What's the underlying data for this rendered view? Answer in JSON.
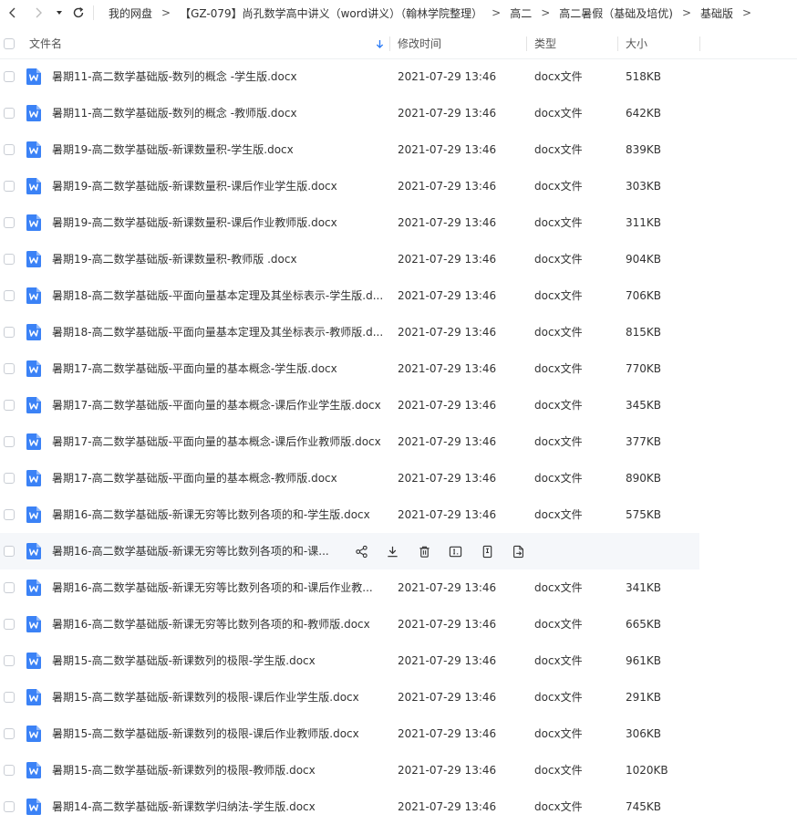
{
  "nav": {
    "back_icon": "chevron-left-icon",
    "forward_icon": "chevron-right-icon",
    "dropdown_icon": "caret-down-icon",
    "refresh_icon": "refresh-icon"
  },
  "breadcrumb": {
    "separator": ">",
    "items": [
      "我的网盘",
      "【GZ-079】尚孔数学高中讲义（word讲义）（翰林学院整理）",
      "高二",
      "高二暑假（基础及培优)",
      "基础版"
    ]
  },
  "table": {
    "columns": {
      "name": "文件名",
      "modified": "修改时间",
      "type": "类型",
      "size": "大小"
    },
    "sort_icon": "arrow-down-icon",
    "rows": [
      {
        "name": "暑期11-高二数学基础版-数列的概念 -学生版.docx",
        "modified": "2021-07-29 13:46",
        "type": "docx文件",
        "size": "518KB"
      },
      {
        "name": "暑期11-高二数学基础版-数列的概念 -教师版.docx",
        "modified": "2021-07-29 13:46",
        "type": "docx文件",
        "size": "642KB"
      },
      {
        "name": "暑期19-高二数学基础版-新课数量积-学生版.docx",
        "modified": "2021-07-29 13:46",
        "type": "docx文件",
        "size": "839KB"
      },
      {
        "name": "暑期19-高二数学基础版-新课数量积-课后作业学生版.docx",
        "modified": "2021-07-29 13:46",
        "type": "docx文件",
        "size": "303KB"
      },
      {
        "name": "暑期19-高二数学基础版-新课数量积-课后作业教师版.docx",
        "modified": "2021-07-29 13:46",
        "type": "docx文件",
        "size": "311KB"
      },
      {
        "name": "暑期19-高二数学基础版-新课数量积-教师版 .docx",
        "modified": "2021-07-29 13:46",
        "type": "docx文件",
        "size": "904KB"
      },
      {
        "name": "暑期18-高二数学基础版-平面向量基本定理及其坐标表示-学生版.d...",
        "modified": "2021-07-29 13:46",
        "type": "docx文件",
        "size": "706KB"
      },
      {
        "name": "暑期18-高二数学基础版-平面向量基本定理及其坐标表示-教师版.d...",
        "modified": "2021-07-29 13:46",
        "type": "docx文件",
        "size": "815KB"
      },
      {
        "name": "暑期17-高二数学基础版-平面向量的基本概念-学生版.docx",
        "modified": "2021-07-29 13:46",
        "type": "docx文件",
        "size": "770KB"
      },
      {
        "name": "暑期17-高二数学基础版-平面向量的基本概念-课后作业学生版.docx",
        "modified": "2021-07-29 13:46",
        "type": "docx文件",
        "size": "345KB"
      },
      {
        "name": "暑期17-高二数学基础版-平面向量的基本概念-课后作业教师版.docx",
        "modified": "2021-07-29 13:46",
        "type": "docx文件",
        "size": "377KB"
      },
      {
        "name": "暑期17-高二数学基础版-平面向量的基本概念-教师版.docx",
        "modified": "2021-07-29 13:46",
        "type": "docx文件",
        "size": "890KB"
      },
      {
        "name": "暑期16-高二数学基础版-新课无穷等比数列各项的和-学生版.docx",
        "modified": "2021-07-29 13:46",
        "type": "docx文件",
        "size": "575KB"
      },
      {
        "name": "暑期16-高二数学基础版-新课无穷等比数列各项的和-课...",
        "modified": "",
        "type": "",
        "size": "",
        "hover": true
      },
      {
        "name": "暑期16-高二数学基础版-新课无穷等比数列各项的和-课后作业教...",
        "modified": "2021-07-29 13:46",
        "type": "docx文件",
        "size": "341KB"
      },
      {
        "name": "暑期16-高二数学基础版-新课无穷等比数列各项的和-教师版.docx",
        "modified": "2021-07-29 13:46",
        "type": "docx文件",
        "size": "665KB"
      },
      {
        "name": "暑期15-高二数学基础版-新课数列的极限-学生版.docx",
        "modified": "2021-07-29 13:46",
        "type": "docx文件",
        "size": "961KB"
      },
      {
        "name": "暑期15-高二数学基础版-新课数列的极限-课后作业学生版.docx",
        "modified": "2021-07-29 13:46",
        "type": "docx文件",
        "size": "291KB"
      },
      {
        "name": "暑期15-高二数学基础版-新课数列的极限-课后作业教师版.docx",
        "modified": "2021-07-29 13:46",
        "type": "docx文件",
        "size": "306KB"
      },
      {
        "name": "暑期15-高二数学基础版-新课数列的极限-教师版.docx",
        "modified": "2021-07-29 13:46",
        "type": "docx文件",
        "size": "1020KB"
      },
      {
        "name": "暑期14-高二数学基础版-新课数学归纳法-学生版.docx",
        "modified": "2021-07-29 13:46",
        "type": "docx文件",
        "size": "745KB"
      }
    ]
  },
  "row_actions": [
    "share-icon",
    "download-icon",
    "delete-icon",
    "rename-icon",
    "copy-icon",
    "move-icon"
  ],
  "colors": {
    "accent": "#2d7cf6",
    "file_icon": "#3b82f6",
    "hover_bg": "#f5f7fa"
  }
}
